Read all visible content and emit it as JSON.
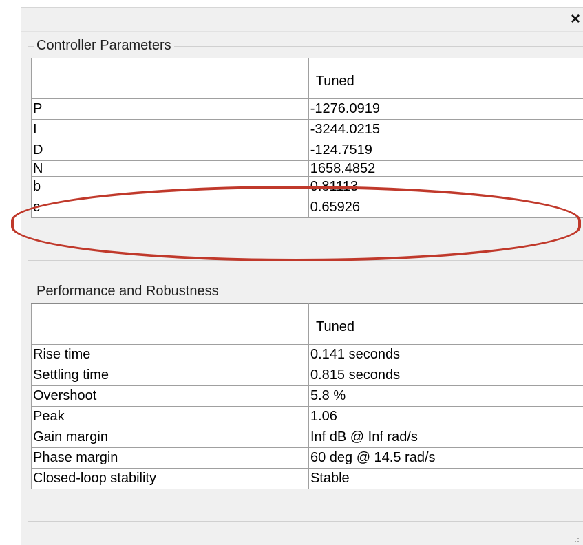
{
  "window": {
    "close_icon": "close-icon",
    "close_glyph": "×"
  },
  "controller_parameters": {
    "legend": "Controller Parameters",
    "column_header": "Tuned",
    "rows": [
      {
        "name": "P",
        "value": "-1276.0919"
      },
      {
        "name": "I",
        "value": "-3244.0215"
      },
      {
        "name": "D",
        "value": "-124.7519"
      },
      {
        "name": "N",
        "value": "1658.4852"
      },
      {
        "name": "b",
        "value": "0.81113"
      },
      {
        "name": "c",
        "value": "0.65926"
      }
    ],
    "highlight_color": "#c0392b"
  },
  "performance": {
    "legend": "Performance and Robustness",
    "column_header": "Tuned",
    "rows": [
      {
        "name": "Rise time",
        "value": "0.141 seconds"
      },
      {
        "name": "Settling time",
        "value": "0.815 seconds"
      },
      {
        "name": "Overshoot",
        "value": "5.8 %"
      },
      {
        "name": "Peak",
        "value": "1.06"
      },
      {
        "name": "Gain margin",
        "value": "Inf dB @ Inf rad/s"
      },
      {
        "name": "Phase margin",
        "value": "60 deg @ 14.5 rad/s"
      },
      {
        "name": "Closed-loop stability",
        "value": "Stable"
      }
    ]
  }
}
